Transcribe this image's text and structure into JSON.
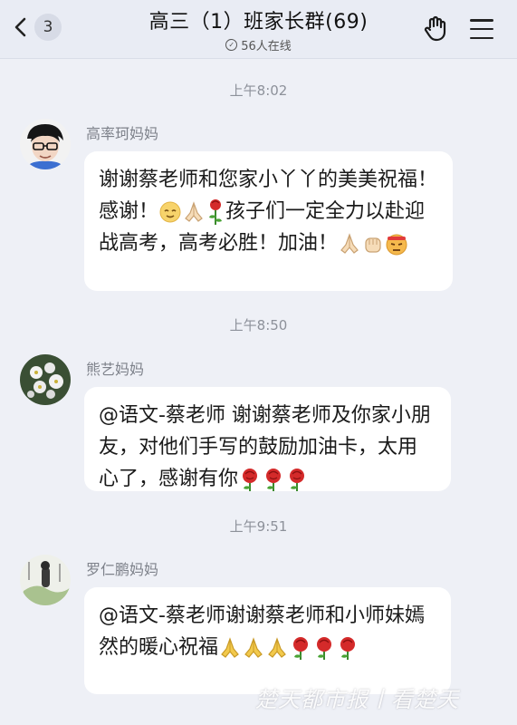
{
  "header": {
    "back_badge": "3",
    "title": "高三（1）班家长群(69)",
    "online": "56人在线"
  },
  "messages": [
    {
      "time": "上午8:02",
      "sender": "高率珂妈妈",
      "text": [
        "谢谢蔡老师和您家小丫丫的美美祝福！感谢！",
        "孩子们一定全力以赴迎战高考，高考必胜！加油！"
      ]
    },
    {
      "time": "上午8:50",
      "sender": "熊艺妈妈",
      "text": [
        "@语文-蔡老师 谢谢蔡老师及你家小朋友，对他们手写的鼓励加油卡，太用心了，感谢有你"
      ]
    },
    {
      "time": "上午9:51",
      "sender": "罗仁鹏妈妈",
      "text": [
        "@语文-蔡老师谢谢蔡老师和小师妹嫣然的暖心祝福"
      ]
    }
  ],
  "watermark": "楚天都市报丨看楚天",
  "icons": {
    "back": "chevron-left-icon",
    "online": "check-circle-icon",
    "hand": "hand-gesture-icon",
    "menu": "menu-icon",
    "emoji": [
      "smile-emoji",
      "praying-hands-emoji",
      "rose-emoji",
      "fist-emoji",
      "determined-face-emoji"
    ]
  }
}
